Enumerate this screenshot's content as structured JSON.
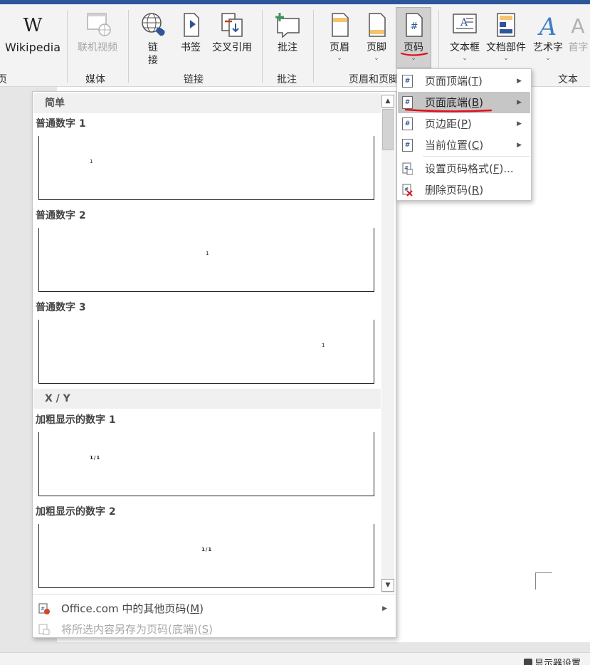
{
  "ribbon": {
    "buttons": {
      "wikipedia": "Wikipedia",
      "online_video": "联机视频",
      "link": "链\n接",
      "bookmark": "书签",
      "cross_ref": "交叉引用",
      "comment": "批注",
      "header": "页眉",
      "footer": "页脚",
      "page_number": "页码",
      "textbox": "文本框",
      "quick_parts": "文档部件",
      "wordart": "艺术字",
      "drop_cap": "首字"
    },
    "groups": {
      "clipped": "页",
      "media": "媒体",
      "links": "链接",
      "comments": "批注",
      "header_footer": "页眉和页脚",
      "text": "文本"
    }
  },
  "gallery": {
    "sections": [
      {
        "header": "简单"
      },
      {
        "header": "X / Y"
      }
    ],
    "items": [
      {
        "title": "普通数字 1",
        "sample": "1"
      },
      {
        "title": "普通数字 2",
        "sample": "1"
      },
      {
        "title": "普通数字 3",
        "sample": "1"
      },
      {
        "title": "加粗显示的数字 1",
        "sample": "1/1"
      },
      {
        "title": "加粗显示的数字 2",
        "sample": "1/1"
      }
    ],
    "footer": {
      "more": "Office.com 中的其他页码",
      "more_key": "M",
      "save": "将所选内容另存为页码(底端)",
      "save_key": "S"
    }
  },
  "submenu": {
    "items": [
      {
        "label": "页面顶端",
        "key": "T",
        "icon": "#"
      },
      {
        "label": "页面底端",
        "key": "B",
        "icon": "#"
      },
      {
        "label": "页边距",
        "key": "P",
        "icon": "#"
      },
      {
        "label": "当前位置",
        "key": "C",
        "icon": "#"
      },
      {
        "label": "设置页码格式",
        "key": "F",
        "suffix": "..."
      },
      {
        "label": "删除页码",
        "key": "R"
      }
    ]
  },
  "statusbar": {
    "display_settings": "显示器设置"
  },
  "colors": {
    "title_bar": "#2b579a",
    "annotation_red": "#e0101a",
    "icon_blue": "#2f5597"
  }
}
